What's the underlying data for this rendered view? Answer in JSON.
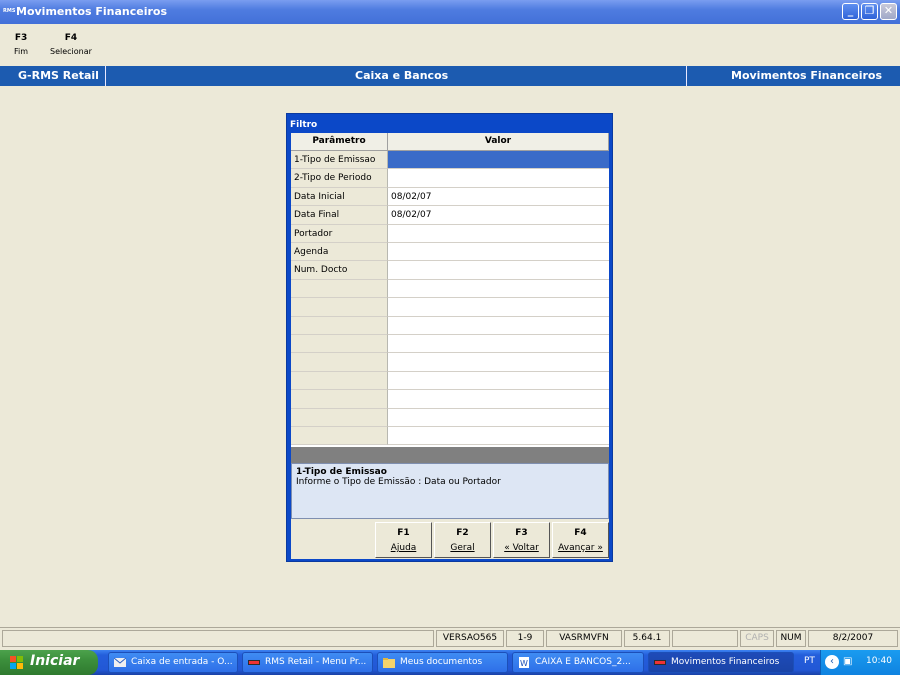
{
  "window": {
    "title": "Movimentos Financeiros",
    "logo_text": "RMS"
  },
  "fkeys": [
    {
      "key": "F3",
      "label": "Fim"
    },
    {
      "key": "F4",
      "label": "Selecionar"
    }
  ],
  "header": {
    "left": "G-RMS Retail",
    "center": "Caixa e Bancos",
    "right": "Movimentos Financeiros"
  },
  "dialog": {
    "title": "Filtro",
    "columns": [
      "Parâmetro",
      "Valor"
    ],
    "rows": [
      {
        "param": "1-Tipo de Emissao",
        "value": ""
      },
      {
        "param": "2-Tipo de Periodo",
        "value": ""
      },
      {
        "param": "Data Inicial",
        "value": "08/02/07"
      },
      {
        "param": "Data Final",
        "value": "08/02/07"
      },
      {
        "param": "Portador",
        "value": ""
      },
      {
        "param": "Agenda",
        "value": ""
      },
      {
        "param": "Num. Docto",
        "value": ""
      }
    ],
    "help_title": "1-Tipo de Emissao",
    "help_text": "Informe o Tipo de Emissão : Data ou Portador",
    "buttons": [
      {
        "key": "F1",
        "label": "Ajuda"
      },
      {
        "key": "F2",
        "label": "Geral"
      },
      {
        "key": "F3",
        "label": "« Voltar"
      },
      {
        "key": "F4",
        "label": "Avançar »"
      }
    ]
  },
  "status": {
    "version": "VERSAO565",
    "page": "1-9",
    "program": "VASRMVFN",
    "build": "5.64.1",
    "caps": "CAPS",
    "num": "NUM",
    "date": "8/2/2007"
  },
  "taskbar": {
    "start": "Iniciar",
    "items": [
      "Caixa de entrada - O...",
      "RMS Retail - Menu Pr...",
      "Meus documentos",
      "CAIXA E BANCOS_2...",
      "Movimentos Financeiros"
    ],
    "lang": "PT",
    "time": "10:40"
  },
  "colors": {
    "band": "#1c5bb0",
    "dialog": "#0b48c8",
    "selected": "#3a6bc8"
  }
}
